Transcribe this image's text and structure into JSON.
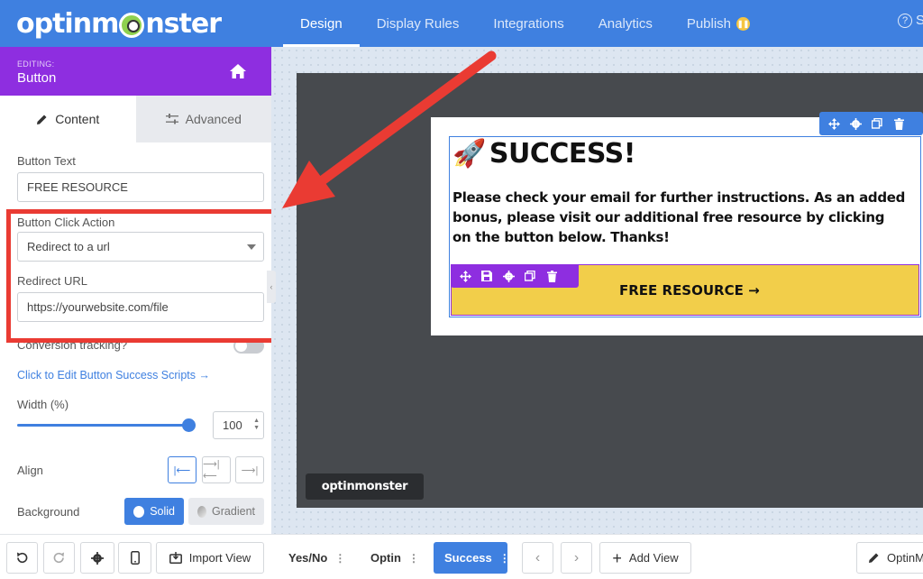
{
  "app": {
    "logo_text_left": "optinm",
    "logo_text_right": "nster",
    "nav_tabs": [
      {
        "label": "Design"
      },
      {
        "label": "Display Rules"
      },
      {
        "label": "Integrations"
      },
      {
        "label": "Analytics"
      },
      {
        "label": "Publish"
      }
    ],
    "help_label": "S",
    "accent_color": "#3f80e0",
    "editing_color": "#8e2ee0",
    "highlight_color": "#ea3b33"
  },
  "sidebar": {
    "editing_small": "EDITING:",
    "editing_title": "Button",
    "tabs": [
      {
        "label": "Content"
      },
      {
        "label": "Advanced"
      }
    ],
    "button_text_label": "Button Text",
    "button_text_value": "FREE RESOURCE",
    "click_action_label": "Button Click Action",
    "click_action_value": "Redirect to a url",
    "redirect_label": "Redirect URL",
    "redirect_value": "https://yourwebsite.com/file",
    "conversion_label": "Conversion tracking?",
    "success_scripts_link": "Click to Edit Button Success Scripts →",
    "width_label": "Width (%)",
    "width_value": "100",
    "width_fraction": 1.0,
    "align_label": "Align",
    "background_label": "Background",
    "bg_solid_label": "Solid",
    "bg_gradient_label": "Gradient"
  },
  "canvas": {
    "headline_emoji": "🚀",
    "headline": "SUCCESS!",
    "body": "Please check your email for further instructions. As an added bonus, please visit our additional free resource by clicking on the button below. Thanks!",
    "cta_label": "FREE RESOURCE →",
    "cta_color": "#f2ce4a",
    "canvas_logo": "optinmonster"
  },
  "bottombar": {
    "import_view_label": "Import View",
    "views": [
      {
        "label": "Yes/No"
      },
      {
        "label": "Optin"
      },
      {
        "label": "Success"
      }
    ],
    "add_view_label": "Add View",
    "optin_label": "OptinM"
  }
}
